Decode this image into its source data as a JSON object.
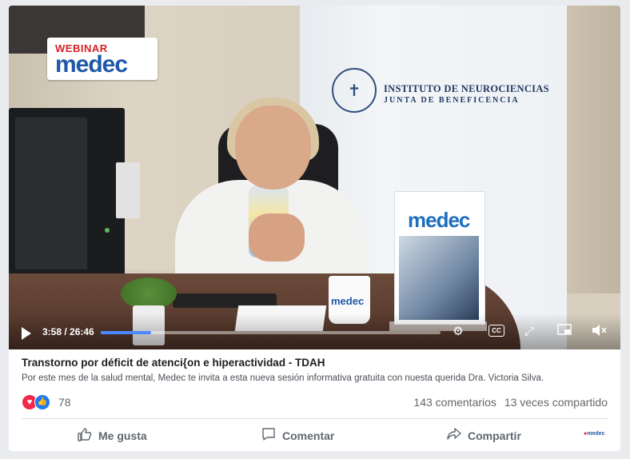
{
  "video": {
    "badge_top": "WEBINAR",
    "badge_main": "medec",
    "banner_line1": "INSTITUTO DE NEUROCIENCIAS",
    "banner_line2": "JUNTA DE BENEFICENCIA",
    "mug_text": "medec",
    "magazine_title": "medec",
    "time": "3:58 / 26:46",
    "progress_fraction": 0.149,
    "cc_label": "CC"
  },
  "post": {
    "title": "Transtorno por déficit de atenci{on e hiperactividad - TDAH",
    "description": "Por este mes de la salud mental, Medec te invita a esta nueva sesión informativa gratuita con nuesta querida Dra. Victoria Silva.",
    "reaction_count": "78",
    "comments": "143 comentarios",
    "shares": "13 veces compartido"
  },
  "actions": {
    "like": "Me gusta",
    "comment": "Comentar",
    "share": "Compartir"
  },
  "icons": {
    "like": "thumbs-up-icon",
    "comment": "comment-icon",
    "share": "share-arrow-icon"
  },
  "colors": {
    "accent": "#4b88ff",
    "brand_red": "#d61f26",
    "brand_blue": "#1f58a8",
    "love": "#f0284a",
    "like": "#2078f4"
  }
}
